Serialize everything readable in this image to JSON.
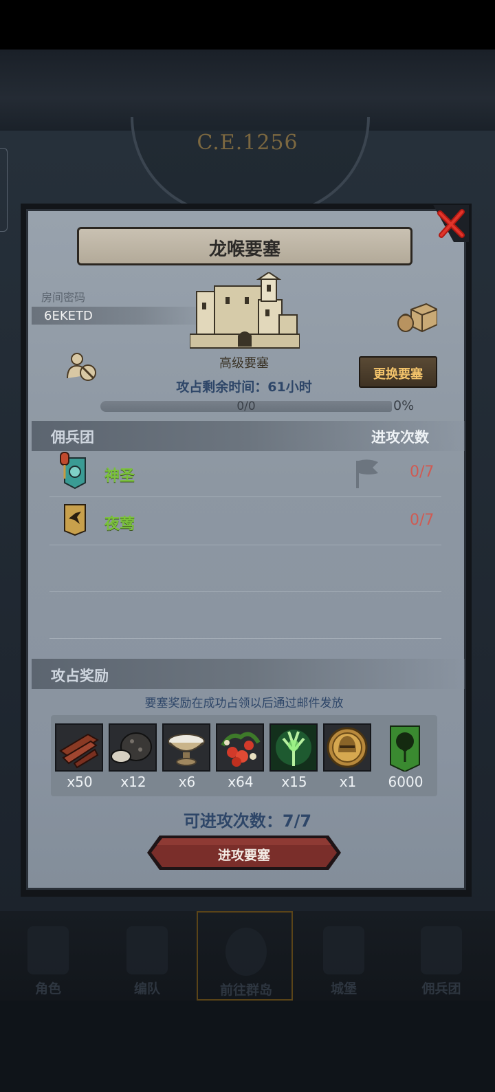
{
  "background": {
    "year_label": "C.E.1256"
  },
  "bottom_nav": [
    {
      "label": "角色",
      "icon": "knight-icon"
    },
    {
      "label": "编队",
      "icon": "helmet-icon"
    },
    {
      "label": "前往群岛",
      "icon": "globe-icon",
      "active": true
    },
    {
      "label": "城堡",
      "icon": "castle-icon"
    },
    {
      "label": "佣兵团",
      "icon": "mercenary-icon"
    }
  ],
  "modal": {
    "title": "龙喉要塞",
    "room_code_label": "房间密码",
    "room_code": "6EKETD",
    "fortress_type": "高级要塞",
    "change_button": "更换要塞",
    "remaining_time": "攻占剩余时间：61小时",
    "progress": {
      "text": "0/0",
      "percent_label": "0%",
      "value": 0
    },
    "mercenary_header": "佣兵团",
    "attack_count_header": "进攻次数",
    "guilds": [
      {
        "name": "神圣",
        "count": "0/7",
        "emblem": "holy-banner-icon",
        "flag": true
      },
      {
        "name": "夜莺",
        "count": "0/7",
        "emblem": "nightingale-banner-icon",
        "flag": false
      }
    ],
    "reward_header": "攻占奖励",
    "reward_note": "要塞奖励在成功占领以后通过邮件发放",
    "rewards": [
      {
        "icon": "wood-planks-icon",
        "qty": "x50"
      },
      {
        "icon": "ore-rock-icon",
        "qty": "x12"
      },
      {
        "icon": "silver-bowl-icon",
        "qty": "x6"
      },
      {
        "icon": "berries-icon",
        "qty": "x64"
      },
      {
        "icon": "green-tree-spirit-icon",
        "qty": "x15"
      },
      {
        "icon": "gold-helmet-medal-icon",
        "qty": "x1"
      },
      {
        "icon": "guild-banner-icon",
        "qty": "6000"
      }
    ],
    "attempts": "可进攻次数：7/7",
    "attack_button": "进攻要塞"
  },
  "colors": {
    "guild_name": "#7ac23a",
    "guild_count": "#d05a52",
    "change_button_text": "#f4c46b",
    "attack_button": "#7a2e2a"
  }
}
